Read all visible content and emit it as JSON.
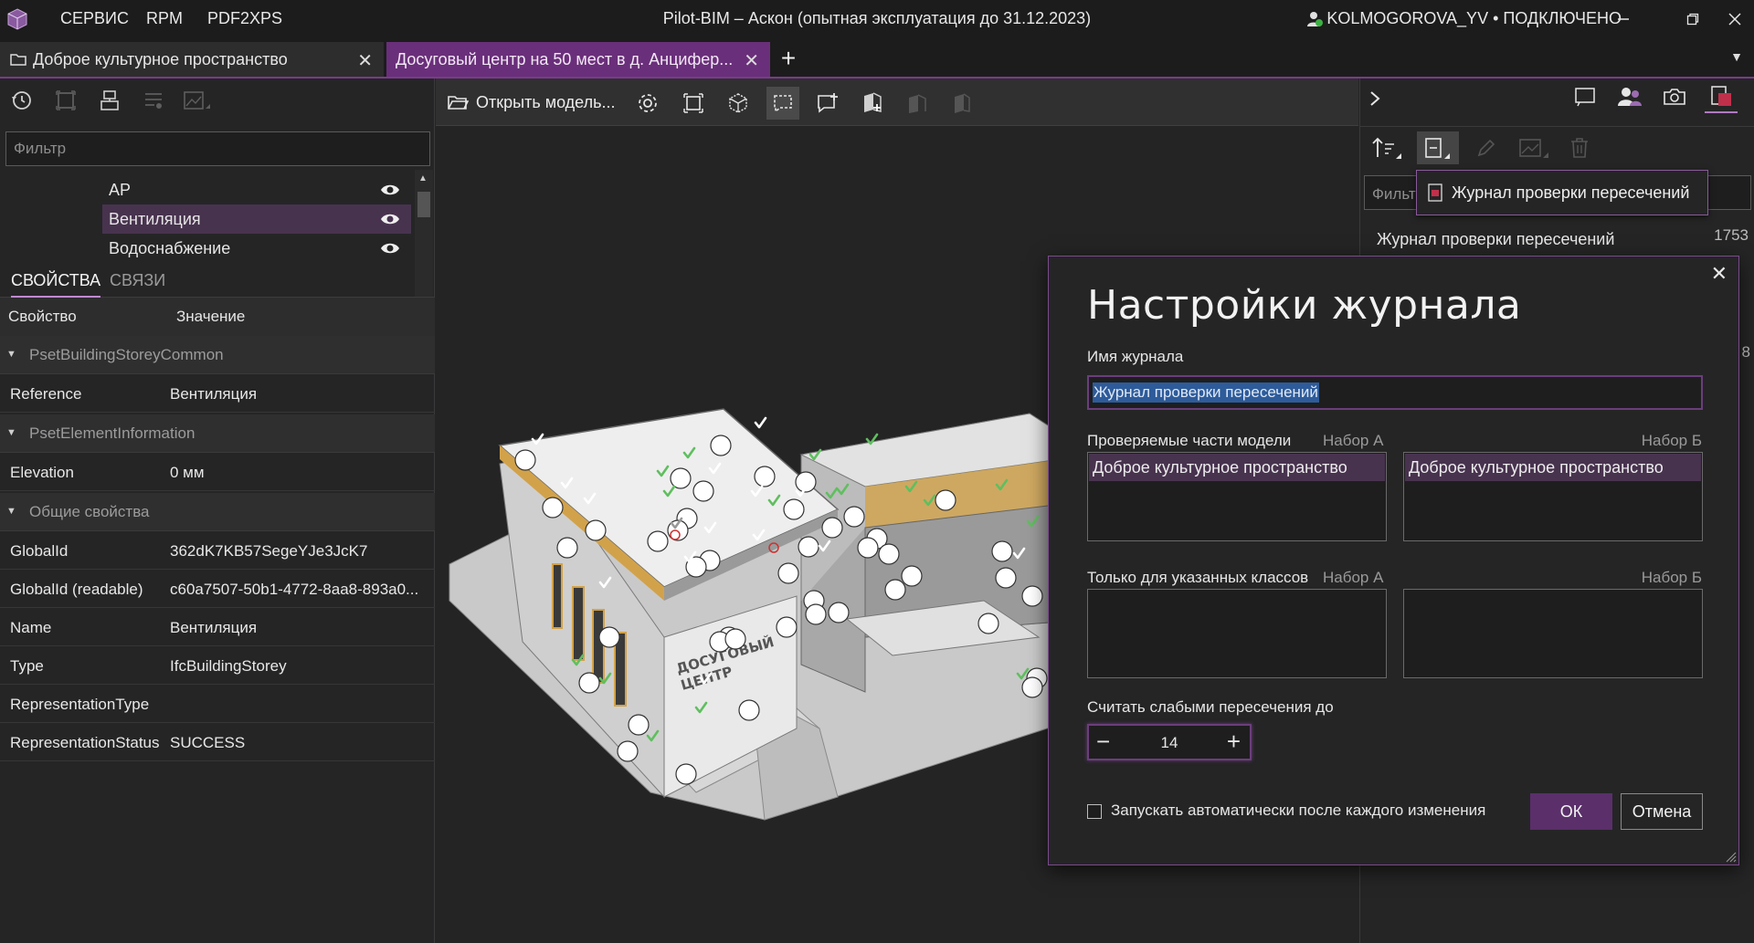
{
  "titlebar": {
    "menus": [
      "СЕРВИС",
      "RPM",
      "PDF2XPS"
    ],
    "app_title": "Pilot-BIM – Аскон (опытная эксплуатация до 31.12.2023)",
    "user_status": "KOLMOGOROVA_YV • ПОДКЛЮЧЕНО"
  },
  "tabs": [
    {
      "label": "Доброе культурное пространство",
      "active": false
    },
    {
      "label": "Досуговый центр на 50 мест в д. Анцифер...",
      "active": true
    }
  ],
  "new_tab_label": "+",
  "left_panel": {
    "filter_placeholder": "Фильтр",
    "tree": [
      {
        "label": "АР",
        "selected": false
      },
      {
        "label": "Вентиляция",
        "selected": true
      },
      {
        "label": "Водоснабжение",
        "selected": false
      }
    ],
    "props_tabs": [
      "СВОЙСТВА",
      "СВЯЗИ"
    ],
    "props_header": {
      "key": "Свойство",
      "value": "Значение"
    },
    "groups": [
      {
        "name": "PsetBuildingStoreyCommon",
        "rows": [
          {
            "key": "Reference",
            "value": "Вентиляция"
          }
        ]
      },
      {
        "name": "PsetElementInformation",
        "rows": [
          {
            "key": "Elevation",
            "value": "0 мм"
          }
        ]
      },
      {
        "name": "Общие свойства",
        "rows": [
          {
            "key": "GlobalId",
            "value": "362dK7KB57SegeYJe3JcK7"
          },
          {
            "key": "GlobalId (readable)",
            "value": "c60a7507-50b1-4772-8aa8-893a0..."
          },
          {
            "key": "Name",
            "value": "Вентиляция"
          },
          {
            "key": "Type",
            "value": "IfcBuildingStorey"
          },
          {
            "key": "RepresentationType",
            "value": ""
          },
          {
            "key": "RepresentationStatus",
            "value": "SUCCESS"
          }
        ]
      }
    ]
  },
  "viewport": {
    "open_model_label": "Открыть модель...",
    "building_sign": [
      "ДОСУГОВЫЙ",
      "ЦЕНТР"
    ]
  },
  "right_panel": {
    "filter_placeholder": "Фильт",
    "popup_label": "Журнал проверки пересечений",
    "list_item": "Журнал проверки пересечений",
    "count": "1753",
    "count2": "8"
  },
  "dialog": {
    "title": "Настройки журнала",
    "name_label": "Имя журнала",
    "name_value": "Журнал проверки пересечений",
    "parts_label": "Проверяемые части модели",
    "set_a": "Набор А",
    "set_b": "Набор Б",
    "parts_a": [
      "Доброе культурное пространство"
    ],
    "parts_b": [
      "Доброе культурное пространство"
    ],
    "classes_label": "Только для указанных классов",
    "weak_label": "Считать слабыми пересечения до",
    "weak_value": "14",
    "minus": "−",
    "plus": "+",
    "auto_label": "Запускать автоматически после каждого изменения",
    "ok": "ОК",
    "cancel": "Отмена",
    "close": "✕"
  },
  "colors": {
    "accent": "#6a2f7a",
    "selection": "#48334f",
    "check": "#5fbf5f"
  }
}
